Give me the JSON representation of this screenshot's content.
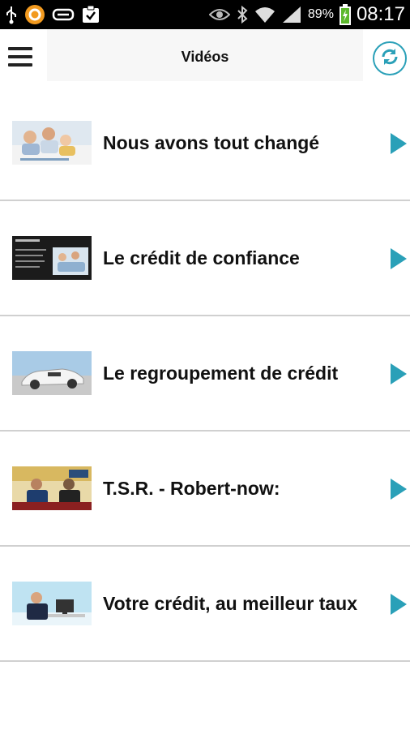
{
  "statusbar": {
    "battery_percent": "89%",
    "time": "08:17"
  },
  "header": {
    "title": "Vidéos"
  },
  "videos": [
    {
      "title": "Nous avons tout changé",
      "thumb": "family-on-couch"
    },
    {
      "title": "Le crédit de confiance",
      "thumb": "dark-slide-with-family"
    },
    {
      "title": "Le regroupement de crédit",
      "thumb": "white-sports-car"
    },
    {
      "title": "T.S.R. - Robert-now:",
      "thumb": "tv-studio-interview"
    },
    {
      "title": "Votre crédit, au meilleur taux",
      "thumb": "man-at-desk"
    }
  ],
  "colors": {
    "accent": "#2aa0b8",
    "divider": "#d0d0d0"
  }
}
